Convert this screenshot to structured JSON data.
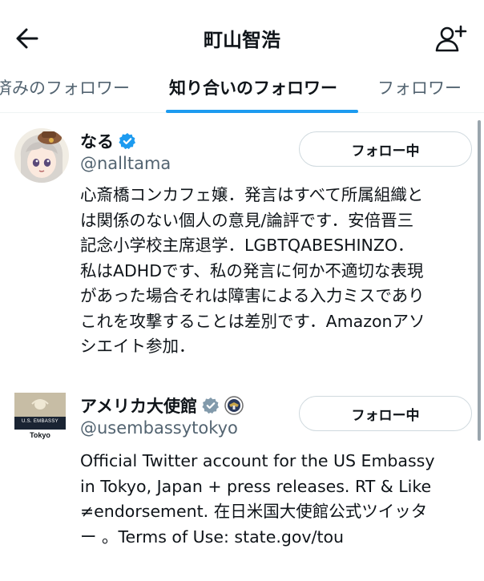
{
  "header": {
    "title": "町山智浩",
    "back_icon": "arrow-left-icon",
    "add_icon": "person-add-icon"
  },
  "tabs": [
    {
      "label": "済みのフォロワー",
      "active": false
    },
    {
      "label": "知り合いのフォロワー",
      "active": true
    },
    {
      "label": "フォロワー",
      "active": false
    }
  ],
  "users": [
    {
      "name": "なる",
      "handle": "@nalltama",
      "verified": true,
      "follow_label": "フォロー中",
      "bio_lines": [
        "心斎橋コンカフェ嬢．発言はすべて所属組織と",
        "は関係のない個人の意見/論評です．安倍晋三",
        "記念小学校主席退学．LGBTQABESHINZO．",
        "私はADHDです、私の発言に何か不適切な表現",
        "があった場合それは障害による入力ミスであり",
        "これを攻撃することは差別です．Amazonアソ",
        "シエイト参加．"
      ]
    },
    {
      "name": "アメリカ大使館",
      "handle": "@usembassytokyo",
      "verified": true,
      "government_badge": true,
      "follow_label": "フォロー中",
      "avatar_text_top": "U.S. EMBASSY",
      "avatar_text_bottom": "Tokyo",
      "bio_lines": [
        "Official Twitter account for the US Embassy",
        "in Tokyo, Japan + press releases. RT & Like",
        "≠endorsement. 在日米国大使館公式ツイッタ",
        "ー 。Terms of Use: state.gov/tou"
      ]
    }
  ],
  "colors": {
    "accent": "#1d9bf0",
    "text": "#0f1419",
    "secondary": "#536471",
    "verified_gray": "#829aab"
  }
}
